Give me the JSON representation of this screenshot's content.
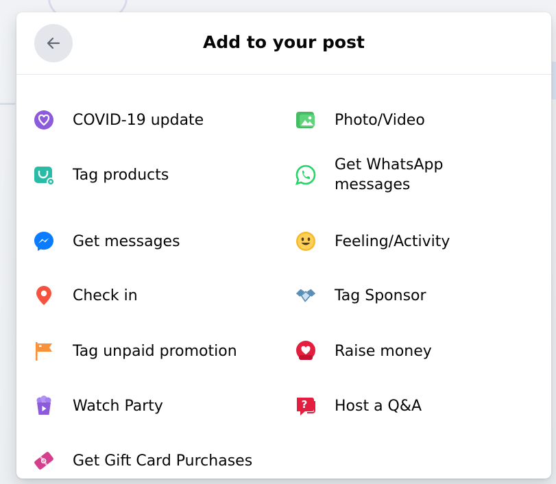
{
  "dialog": {
    "title": "Add to your post",
    "back_icon": "arrow-left-icon"
  },
  "items": [
    {
      "label": "COVID-19 update",
      "icon": "covid-heart-icon",
      "color": "#8c5bdb"
    },
    {
      "label": "Photo/Video",
      "icon": "photo-video-icon",
      "color": "#45bd62"
    },
    {
      "label": "Tag products",
      "icon": "shopping-bag-icon",
      "color": "#2abba7"
    },
    {
      "label": "Get WhatsApp messages",
      "icon": "whatsapp-icon",
      "color": "#25d366"
    },
    {
      "label": "Get messages",
      "icon": "messenger-icon",
      "color": "#0a7cff"
    },
    {
      "label": "Feeling/Activity",
      "icon": "smiley-icon",
      "color": "#f7b928"
    },
    {
      "label": "Check in",
      "icon": "location-pin-icon",
      "color": "#f5533d"
    },
    {
      "label": "Tag Sponsor",
      "icon": "handshake-icon",
      "color": "#5a8fb8"
    },
    {
      "label": "Tag unpaid promotion",
      "icon": "flag-icon",
      "color": "#f7923b"
    },
    {
      "label": "Raise money",
      "icon": "fundraiser-heart-icon",
      "color": "#e41e3f"
    },
    {
      "label": "Watch Party",
      "icon": "popcorn-icon",
      "color": "#8c5bdb"
    },
    {
      "label": "Host a Q&A",
      "icon": "question-bubble-icon",
      "color": "#e41e3f"
    },
    {
      "label": "Get Gift Card Purchases",
      "icon": "gift-card-icon",
      "color": "#d43f8d"
    }
  ]
}
